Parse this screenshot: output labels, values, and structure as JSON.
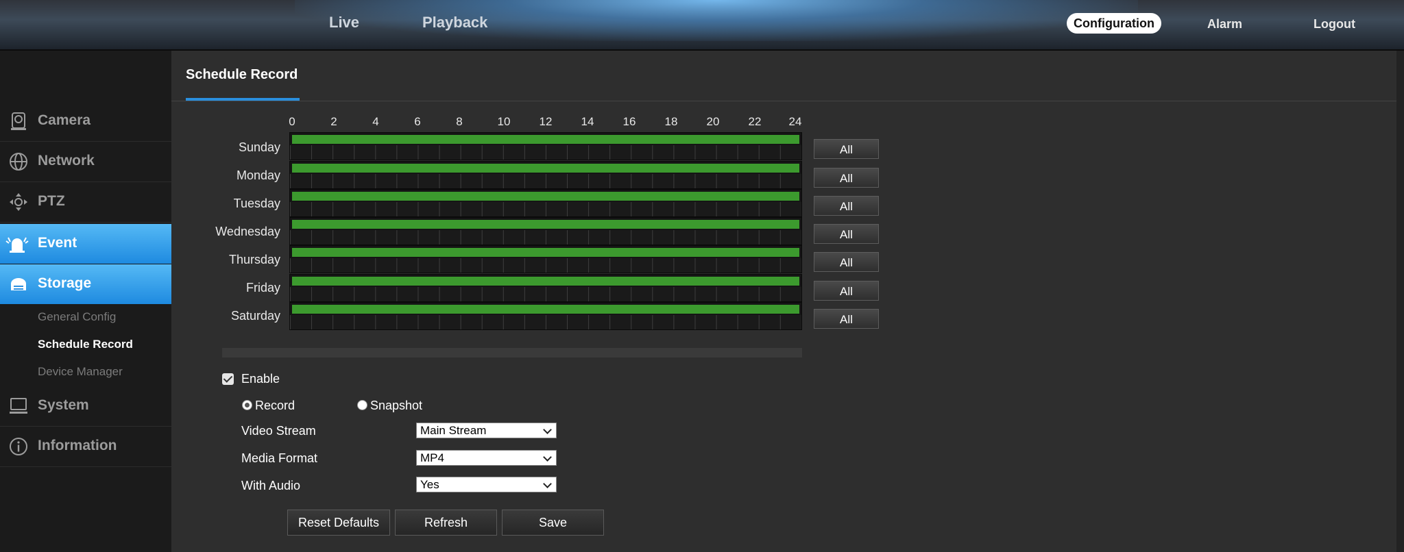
{
  "topnav": {
    "live": "Live",
    "playback": "Playback",
    "configuration": "Configuration",
    "alarm": "Alarm",
    "logout": "Logout"
  },
  "sidebar": {
    "items": [
      {
        "label": "Camera",
        "icon": "camera-icon"
      },
      {
        "label": "Network",
        "icon": "network-icon"
      },
      {
        "label": "PTZ",
        "icon": "ptz-icon"
      },
      {
        "label": "Event",
        "icon": "alarm-bell-icon"
      },
      {
        "label": "Storage",
        "icon": "storage-icon"
      },
      {
        "label": "System",
        "icon": "monitor-icon"
      },
      {
        "label": "Information",
        "icon": "info-icon"
      }
    ],
    "storage_sub": [
      "General Config",
      "Schedule Record",
      "Device Manager"
    ]
  },
  "page": {
    "title": "Schedule Record"
  },
  "schedule": {
    "hours": [
      "0",
      "2",
      "4",
      "6",
      "8",
      "10",
      "12",
      "14",
      "16",
      "18",
      "20",
      "22",
      "24"
    ],
    "days": [
      "Sunday",
      "Monday",
      "Tuesday",
      "Wednesday",
      "Thursday",
      "Friday",
      "Saturday"
    ],
    "all_label": "All",
    "recorded_hours": [
      0,
      24
    ]
  },
  "form": {
    "enable_label": "Enable",
    "enable_checked": true,
    "record_label": "Record",
    "snapshot_label": "Snapshot",
    "mode_selected": "Record",
    "video_stream_label": "Video Stream",
    "video_stream_value": "Main Stream",
    "media_format_label": "Media Format",
    "media_format_value": "MP4",
    "with_audio_label": "With Audio",
    "with_audio_value": "Yes"
  },
  "actions": {
    "reset": "Reset Defaults",
    "refresh": "Refresh",
    "save": "Save"
  },
  "colors": {
    "accent_blue": "#2a8fdd",
    "schedule_green": "#3c9a2e"
  }
}
